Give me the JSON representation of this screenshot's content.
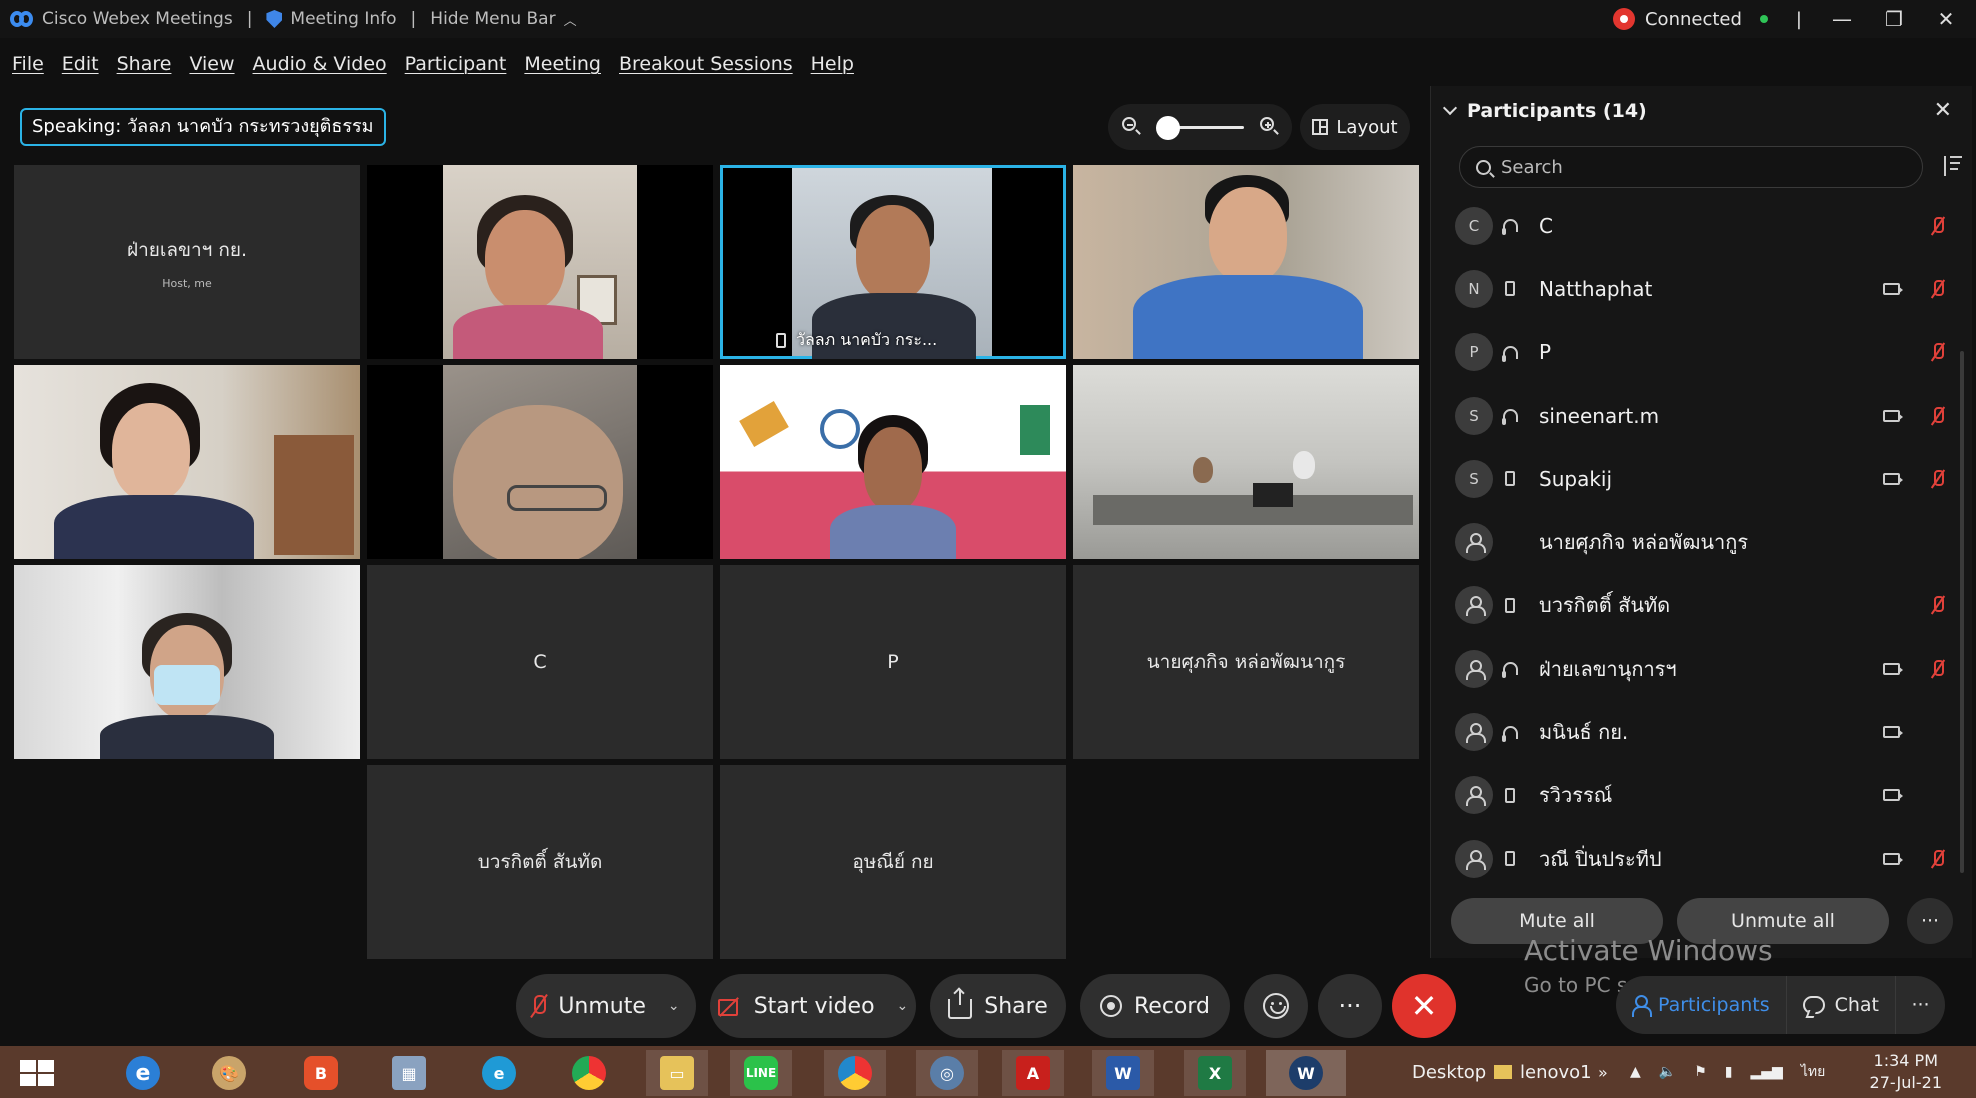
{
  "titlebar": {
    "app_name": "Cisco Webex Meetings",
    "meeting_info": "Meeting Info",
    "hide_menu": "Hide Menu Bar",
    "status": "Connected"
  },
  "menu": [
    "File",
    "Edit",
    "Share",
    "View",
    "Audio & Video",
    "Participant",
    "Meeting",
    "Breakout Sessions",
    "Help"
  ],
  "speaking": "Speaking: วัลลภ นาคบัว กระทรวงยุติธรรม",
  "layout_label": "Layout",
  "tiles": {
    "host_name": "ฝ่ายเลขาฯ กย.",
    "host_sub": "Host, me",
    "active_label": "วัลลภ นาคบัว กระ...",
    "c": "C",
    "p": "P",
    "supakit": "นายศุภกิจ หล่อพัฒนากูร",
    "borakit": "บวรกิตติ์ สันทัด",
    "ounnee": "อุษณีย์ กย"
  },
  "panel": {
    "title": "Participants (14)",
    "search_placeholder": "Search",
    "mute_all": "Mute all",
    "unmute_all": "Unmute all",
    "participants": [
      {
        "initial": "C",
        "name": "C"
      },
      {
        "initial": "N",
        "name": "Natthaphat"
      },
      {
        "initial": "P",
        "name": "P"
      },
      {
        "initial": "S",
        "name": "sineenart.m"
      },
      {
        "initial": "S",
        "name": "Supakij"
      },
      {
        "initial": "",
        "name": "นายศุภกิจ หล่อพัฒนากูร"
      },
      {
        "initial": "",
        "name": "บวรกิตติ์ สันทัด"
      },
      {
        "initial": "",
        "name": "ฝ่ายเลขานุการฯ"
      },
      {
        "initial": "",
        "name": "มนินธ์ กย."
      },
      {
        "initial": "",
        "name": "รวิวรรณ์"
      },
      {
        "initial": "",
        "name": "วณี ปิ่นประทีป"
      }
    ]
  },
  "watermark": {
    "line1": "Activate Windows",
    "line2": "Go to PC settings to activate Windows."
  },
  "controls": {
    "unmute": "Unmute",
    "start_video": "Start video",
    "share": "Share",
    "record": "Record",
    "more": "···",
    "end": "✕",
    "participants_tab": "Participants",
    "chat_tab": "Chat"
  },
  "taskbar": {
    "desktop": "Desktop",
    "user": "lenovo1",
    "lang": "ไทย",
    "time": "1:34 PM",
    "date": "27-Jul-21"
  },
  "colors": {
    "accent": "#2bb3e6",
    "end_call": "#e0332c",
    "muted": "#e0413a",
    "active_tab": "#3f8ee8"
  }
}
